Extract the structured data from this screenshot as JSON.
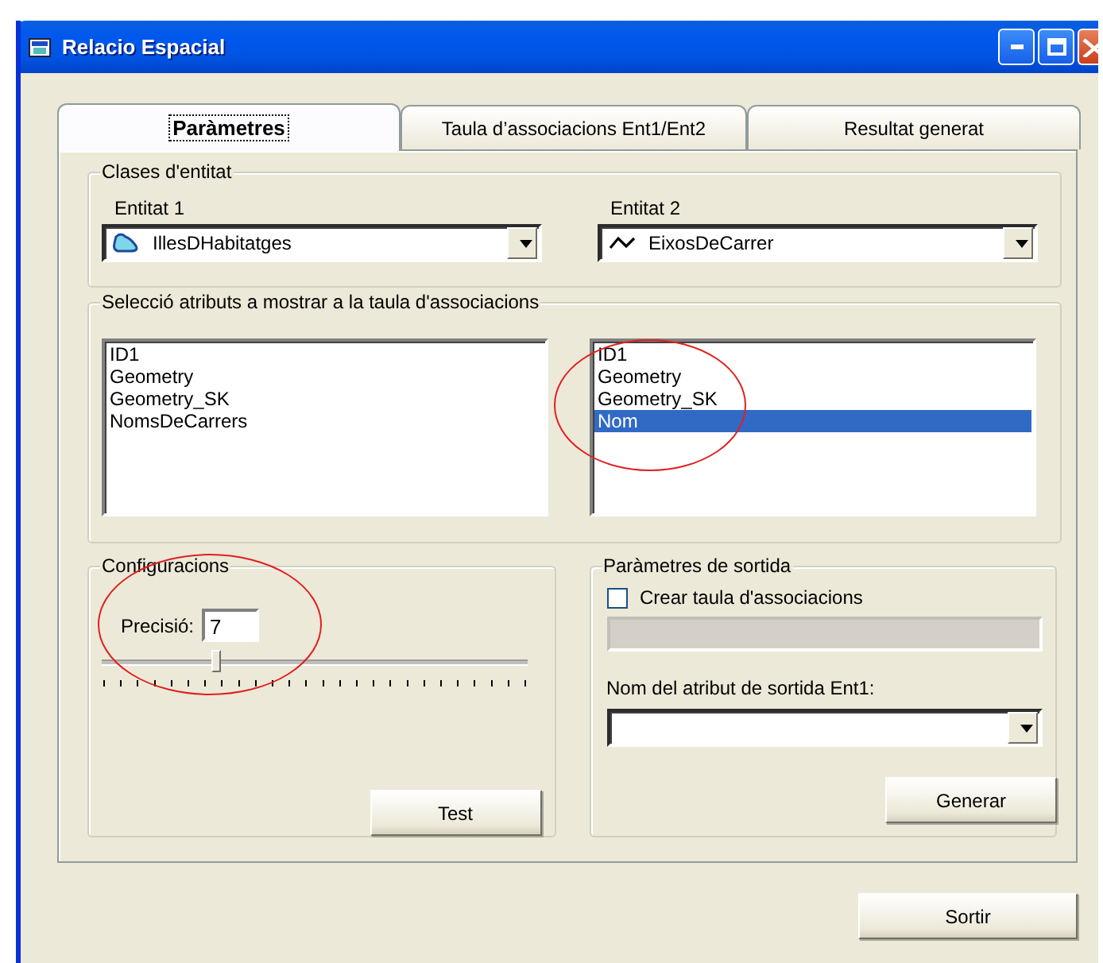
{
  "window": {
    "title": "Relacio Espacial"
  },
  "tabs": [
    {
      "label": "Paràmetres",
      "selected": true
    },
    {
      "label": "Taula d’associacions Ent1/Ent2",
      "selected": false
    },
    {
      "label": "Resultat generat",
      "selected": false
    }
  ],
  "entity_classes": {
    "title": "Clases d'entitat",
    "entities": [
      {
        "label": "Entitat 1",
        "value": "IllesDHabitatges",
        "kind": "polygon"
      },
      {
        "label": "Entitat 2",
        "value": "EixosDeCarrer",
        "kind": "line"
      }
    ]
  },
  "attribute_selection": {
    "title": "Selecció atributs a mostrar a la taula d'associacions",
    "lists": [
      {
        "items": [
          {
            "text": "ID1",
            "selected": false
          },
          {
            "text": "Geometry",
            "selected": false
          },
          {
            "text": "Geometry_SK",
            "selected": false
          },
          {
            "text": "NomsDeCarrers",
            "selected": false
          }
        ]
      },
      {
        "items": [
          {
            "text": "ID1",
            "selected": false
          },
          {
            "text": "Geometry",
            "selected": false
          },
          {
            "text": "Geometry_SK",
            "selected": false
          },
          {
            "text": "Nom",
            "selected": true
          }
        ]
      }
    ]
  },
  "configuration": {
    "title": "Configuracions",
    "precision_label": "Precisió:",
    "precision_value": "7",
    "slider": {
      "level": 0.27
    },
    "test_button": "Test"
  },
  "output": {
    "title": "Paràmetres de sortida",
    "create_table": {
      "label": "Crear taula d'associacions",
      "checked": false
    },
    "table_name_field": {
      "disabled": true
    },
    "attribute_label": "Nom del atribut de sortida Ent1:",
    "generate_button": "Generar"
  },
  "close_button": "Sortir"
}
